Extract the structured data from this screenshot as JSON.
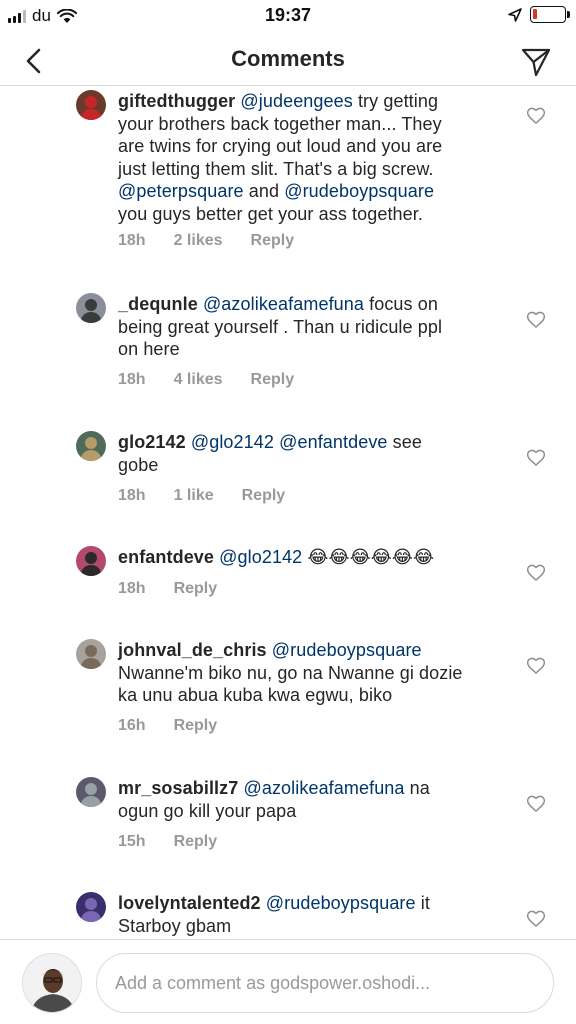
{
  "status_bar": {
    "carrier": "du",
    "time": "19:37",
    "battery_level": 0.12,
    "icons": [
      "signal-icon",
      "wifi-icon",
      "location-arrow-icon",
      "battery-icon"
    ],
    "battery_color": "#e0312c"
  },
  "nav": {
    "title": "Comments",
    "back_icon": "chevron-left-icon",
    "send_icon": "paper-plane-icon"
  },
  "colors": {
    "mention": "#003569",
    "meta": "#999999",
    "text": "#262626"
  },
  "comments": [
    {
      "username": "giftedthugger",
      "lines": [
        [
          {
            "t": "@judeengees",
            "m": true
          },
          {
            "t": " try getting"
          }
        ],
        [
          {
            "t": "your brothers back together man... They"
          }
        ],
        [
          {
            "t": "are twins for crying out loud and you are"
          }
        ],
        [
          {
            "t": "just letting them slit. That's a big screw."
          }
        ],
        [
          {
            "t": "@peterpsquare",
            "m": true
          },
          {
            "t": " and "
          },
          {
            "t": "@rudeboypsquare",
            "m": true
          }
        ],
        [
          {
            "t": "you guys better get your ass together."
          }
        ]
      ],
      "time": "18h",
      "likes": "2 likes",
      "reply": "Reply"
    },
    {
      "username": "_dequnle",
      "lines": [
        [
          {
            "t": "@azolikeafamefuna",
            "m": true
          },
          {
            "t": " focus on"
          }
        ],
        [
          {
            "t": "being great yourself . Than u ridicule ppl"
          }
        ],
        [
          {
            "t": "on here"
          }
        ]
      ],
      "time": "18h",
      "likes": "4 likes",
      "reply": "Reply"
    },
    {
      "username": "glo2142",
      "lines": [
        [
          {
            "t": "@glo2142",
            "m": true
          },
          {
            "t": " "
          },
          {
            "t": "@enfantdeve",
            "m": true
          },
          {
            "t": " see"
          }
        ],
        [
          {
            "t": "gobe"
          }
        ]
      ],
      "time": "18h",
      "likes": "1 like",
      "reply": "Reply"
    },
    {
      "username": "enfantdeve",
      "lines": [
        [
          {
            "t": "@glo2142",
            "m": true
          },
          {
            "t": " 😂😂😂😂😂😂"
          }
        ]
      ],
      "time": "18h",
      "likes": "",
      "reply": "Reply"
    },
    {
      "username": "johnval_de_chris",
      "lines": [
        [
          {
            "t": "@rudeboypsquare",
            "m": true
          }
        ],
        [
          {
            "t": "Nwanne'm biko nu, go na Nwanne gi dozie"
          }
        ],
        [
          {
            "t": "ka unu abua kuba kwa egwu, biko"
          }
        ]
      ],
      "time": "16h",
      "likes": "",
      "reply": "Reply"
    },
    {
      "username": "mr_sosabillz7",
      "lines": [
        [
          {
            "t": "@azolikeafamefuna",
            "m": true
          },
          {
            "t": " na"
          }
        ],
        [
          {
            "t": "ogun go kill your papa"
          }
        ]
      ],
      "time": "15h",
      "likes": "",
      "reply": "Reply"
    },
    {
      "username": "lovelyntalented2",
      "lines": [
        [
          {
            "t": "@rudeboypsquare",
            "m": true
          },
          {
            "t": " it"
          }
        ],
        [
          {
            "t": "Starboy gbam"
          }
        ]
      ],
      "time": "",
      "likes": "",
      "reply": ""
    }
  ],
  "composer": {
    "placeholder": "Add a comment as godspower.oshodi..."
  }
}
